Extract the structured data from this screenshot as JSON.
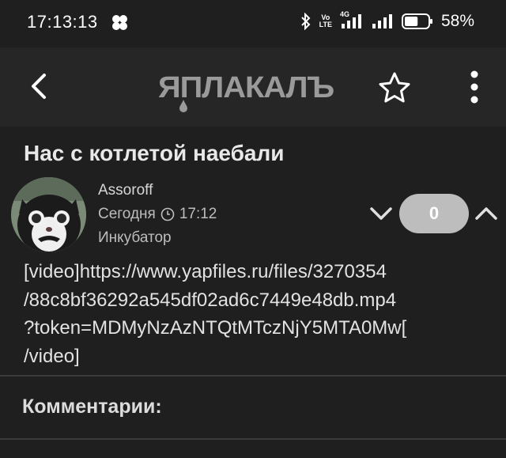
{
  "status_bar": {
    "time": "17:13:13",
    "volte_top": "Vo",
    "volte_bottom": "LTE",
    "network": "4G",
    "battery_percent": "58%",
    "battery_level": 0.58
  },
  "app_bar": {
    "logo_text": "ЯПЛАКАЛЪ",
    "back_icon": "chevron-left-icon",
    "star_icon": "star-outline-icon",
    "menu_icon": "more-vertical-icon"
  },
  "post": {
    "title": "Нас с котлетой наебали",
    "author": "Assoroff",
    "date_label": "Сегодня",
    "time": "17:12",
    "rank": "Инкубатор",
    "vote_count": "0",
    "body_lines": [
      "[video]https://www.yapfiles.ru/files/3270354",
      "/88c8bf36292a545df02ad6c7449e48db.mp4",
      "?token=MDMyNzAzNTQtMTczNjY5MTA0Mw[",
      "/video]"
    ]
  },
  "comments": {
    "title": "Комментарии:"
  },
  "colors": {
    "background": "#1f1f1f",
    "app_bar": "#262626",
    "vote_pill": "#bdbdbd",
    "logo": "#9a9a9a"
  }
}
